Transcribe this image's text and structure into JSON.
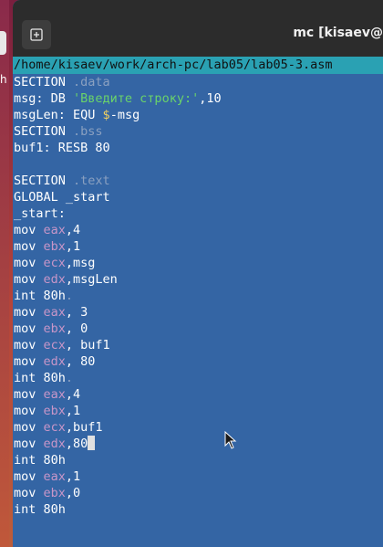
{
  "window": {
    "title": "mc [kisaev@",
    "path": "/home/kisaev/work/arch-pc/lab05/lab05-3.asm"
  },
  "desktop": {
    "edge_char": "h"
  },
  "code_lines": [
    [
      {
        "t": "SECTION ",
        "c": "plain"
      },
      {
        "t": ".data",
        "c": "sect"
      }
    ],
    [
      {
        "t": "msg: DB ",
        "c": "plain"
      },
      {
        "t": "'Введите строку:'",
        "c": "str"
      },
      {
        "t": ",10",
        "c": "plain"
      }
    ],
    [
      {
        "t": "msgLen: EQU ",
        "c": "plain"
      },
      {
        "t": "$",
        "c": "op"
      },
      {
        "t": "-msg",
        "c": "plain"
      }
    ],
    [
      {
        "t": "SECTION ",
        "c": "plain"
      },
      {
        "t": ".bss",
        "c": "sect"
      }
    ],
    [
      {
        "t": "buf1: RESB 80",
        "c": "plain"
      }
    ],
    [
      {
        "t": "",
        "c": "plain"
      }
    ],
    [
      {
        "t": "SECTION ",
        "c": "plain"
      },
      {
        "t": ".text",
        "c": "sect"
      }
    ],
    [
      {
        "t": "GLOBAL _start",
        "c": "plain"
      }
    ],
    [
      {
        "t": "_start:",
        "c": "plain"
      }
    ],
    [
      {
        "t": "mov ",
        "c": "plain"
      },
      {
        "t": "eax",
        "c": "reg"
      },
      {
        "t": ",4",
        "c": "plain"
      }
    ],
    [
      {
        "t": "mov ",
        "c": "plain"
      },
      {
        "t": "ebx",
        "c": "reg"
      },
      {
        "t": ",1",
        "c": "plain"
      }
    ],
    [
      {
        "t": "mov ",
        "c": "plain"
      },
      {
        "t": "ecx",
        "c": "reg"
      },
      {
        "t": ",msg",
        "c": "plain"
      }
    ],
    [
      {
        "t": "mov ",
        "c": "plain"
      },
      {
        "t": "edx",
        "c": "reg"
      },
      {
        "t": ",msgLen",
        "c": "plain"
      }
    ],
    [
      {
        "t": "int 80h",
        "c": "plain"
      },
      {
        "t": ".",
        "c": "dim"
      }
    ],
    [
      {
        "t": "mov ",
        "c": "plain"
      },
      {
        "t": "eax",
        "c": "reg"
      },
      {
        "t": ", 3",
        "c": "plain"
      }
    ],
    [
      {
        "t": "mov ",
        "c": "plain"
      },
      {
        "t": "ebx",
        "c": "reg"
      },
      {
        "t": ", 0",
        "c": "plain"
      }
    ],
    [
      {
        "t": "mov ",
        "c": "plain"
      },
      {
        "t": "ecx",
        "c": "reg"
      },
      {
        "t": ", buf1",
        "c": "plain"
      }
    ],
    [
      {
        "t": "mov ",
        "c": "plain"
      },
      {
        "t": "edx",
        "c": "reg"
      },
      {
        "t": ", 80",
        "c": "plain"
      }
    ],
    [
      {
        "t": "int 80h",
        "c": "plain"
      },
      {
        "t": ".",
        "c": "dim"
      }
    ],
    [
      {
        "t": "mov ",
        "c": "plain"
      },
      {
        "t": "eax",
        "c": "reg"
      },
      {
        "t": ",4",
        "c": "plain"
      }
    ],
    [
      {
        "t": "mov ",
        "c": "plain"
      },
      {
        "t": "ebx",
        "c": "reg"
      },
      {
        "t": ",1",
        "c": "plain"
      }
    ],
    [
      {
        "t": "mov ",
        "c": "plain"
      },
      {
        "t": "ecx",
        "c": "reg"
      },
      {
        "t": ",buf1",
        "c": "plain"
      }
    ],
    [
      {
        "t": "mov ",
        "c": "plain"
      },
      {
        "t": "edx",
        "c": "reg"
      },
      {
        "t": ",80",
        "c": "plain"
      },
      {
        "t": "",
        "c": "cursor"
      }
    ],
    [
      {
        "t": "int 80h",
        "c": "plain"
      }
    ],
    [
      {
        "t": "mov ",
        "c": "plain"
      },
      {
        "t": "eax",
        "c": "reg"
      },
      {
        "t": ",1",
        "c": "plain"
      }
    ],
    [
      {
        "t": "mov ",
        "c": "plain"
      },
      {
        "t": "ebx",
        "c": "reg"
      },
      {
        "t": ",0",
        "c": "plain"
      }
    ],
    [
      {
        "t": "int 80h",
        "c": "plain"
      }
    ]
  ],
  "icons": {
    "new_tab": "new-tab-icon",
    "pointer": "mouse-pointer-icon"
  },
  "colors": {
    "editor_bg": "#3465a4",
    "pathbar_bg": "#2aa1b3",
    "titlebar_bg": "#2c2c2c"
  }
}
